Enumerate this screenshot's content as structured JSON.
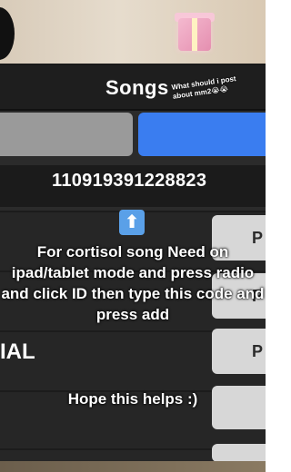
{
  "panel": {
    "title": "Songs",
    "song_id": "110919391228823",
    "row_label": "IAL",
    "play_label": "P"
  },
  "overlay": {
    "sticker_text": "What should i post about mm2😭😭",
    "arrow_glyph": "⬆",
    "caption_lines": "For cortisol song Need on ipad/tablet mode and press radio and click ID then type this code and press add",
    "closing": "Hope this helps :)"
  },
  "colors": {
    "panel_bg": "#2b2b2b",
    "header_bg": "#1e1e1e",
    "tab_grey": "#9a9a9a",
    "tab_blue": "#3a7df0",
    "play_button": "#d7d7d7"
  }
}
